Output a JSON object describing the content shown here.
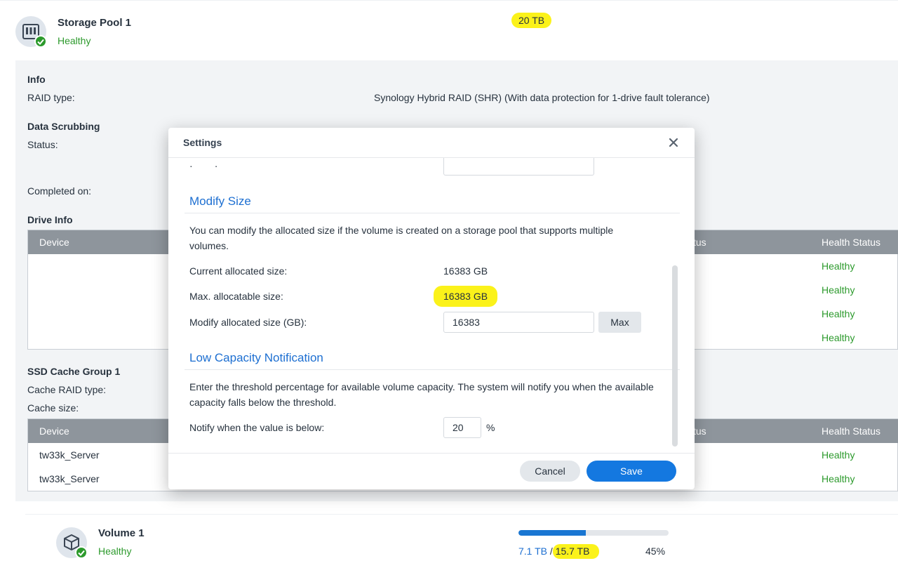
{
  "pool": {
    "name": "Storage Pool 1",
    "status": "Healthy",
    "size": "20 TB"
  },
  "info": {
    "title": "Info",
    "raid_label": "RAID type:",
    "raid_value": "Synology Hybrid RAID (SHR) (With data protection for 1-drive fault tolerance)"
  },
  "scrubbing": {
    "title": "Data Scrubbing",
    "status_label": "Status:",
    "completed_label": "Completed on:"
  },
  "drive_info": {
    "title": "Drive Info",
    "col_device": "Device",
    "col_status_partial": "tus",
    "col_health": "Health Status",
    "rows": [
      "Healthy",
      "Healthy",
      "Healthy",
      "Healthy"
    ]
  },
  "ssd_cache": {
    "title": "SSD Cache Group 1",
    "raid_label": "Cache RAID type:",
    "size_label": "Cache size:",
    "col_device": "Device",
    "col_status_partial": "tus",
    "col_health": "Health Status",
    "rows": [
      {
        "device": "tw33k_Server",
        "health": "Healthy"
      },
      {
        "device": "tw33k_Server",
        "health": "Healthy"
      }
    ]
  },
  "volume": {
    "name": "Volume 1",
    "status": "Healthy",
    "used": "7.1 TB",
    "separator": "/",
    "total": "15.7 TB",
    "percent_label": "45%",
    "used_fraction": 0.45
  },
  "dialog": {
    "title": "Settings",
    "modify_title": "Modify Size",
    "modify_desc": "You can modify the allocated size if the volume is created on a storage pool that supports multiple volumes.",
    "current_label": "Current allocated size:",
    "current_value": "16383 GB",
    "max_label": "Max. allocatable size:",
    "max_value": "16383 GB",
    "modify_label": "Modify allocated size (GB):",
    "modify_value": "16383",
    "max_button": "Max",
    "low_title": "Low Capacity Notification",
    "low_desc": "Enter the threshold percentage for available volume capacity. The system will notify you when the available capacity falls below the threshold.",
    "notify_label": "Notify when the value is below:",
    "notify_value": "20",
    "notify_unit": "%",
    "cancel": "Cancel",
    "save": "Save"
  },
  "colors": {
    "accent": "#1478e0",
    "healthy": "#2c9a2c",
    "highlight": "#fbf21a",
    "table_header": "#8e959c"
  }
}
